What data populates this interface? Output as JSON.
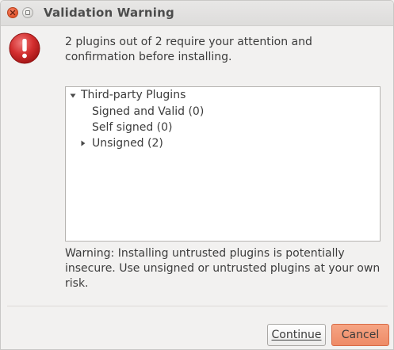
{
  "window": {
    "title": "Validation Warning"
  },
  "message": "2 plugins out of 2 require your attention and confirmation before installing.",
  "tree": {
    "root": {
      "label": "Third-party Plugins",
      "expanded": true,
      "children": [
        {
          "label": "Signed and Valid (0)"
        },
        {
          "label": "Self signed (0)"
        },
        {
          "label": "Unsigned (2)",
          "expanded": false
        }
      ]
    }
  },
  "warning_text": "Warning: Installing untrusted plugins is potentially insecure. Use unsigned or untrusted plugins at your own risk.",
  "buttons": {
    "continue_label": "Continue",
    "cancel_label": "Cancel"
  },
  "colors": {
    "warning_icon": "#d32f2f",
    "cancel_button": "#ef916c",
    "close_button": "#e6572f"
  },
  "icons": {
    "dialog": "warning-icon",
    "expanded": "triangle-down-icon",
    "collapsed": "triangle-right-icon"
  }
}
